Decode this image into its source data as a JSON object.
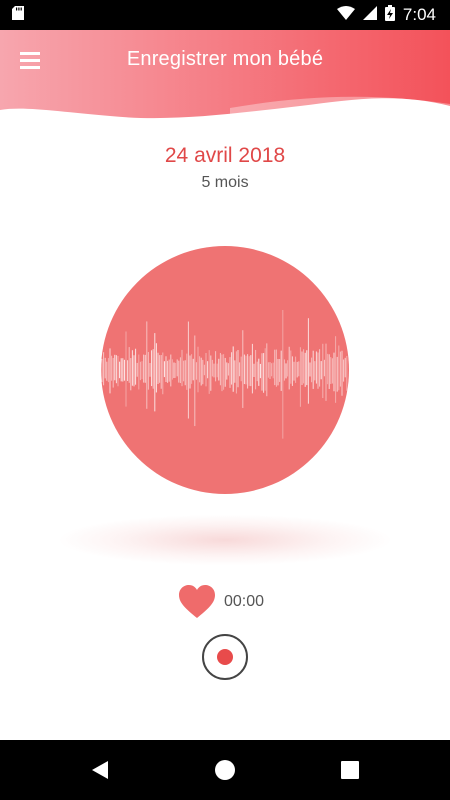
{
  "status_bar": {
    "time": "7:04",
    "icons": [
      "sd-card-icon",
      "wifi-icon",
      "cell-signal-icon",
      "battery-charging-icon"
    ]
  },
  "header": {
    "title": "Enregistrer mon bébé",
    "menu_icon": "hamburger-menu-icon",
    "gradient_colors": [
      "#f7a6ae",
      "#f3525a"
    ]
  },
  "recording": {
    "date": "24 avril 2018",
    "age": "5 mois",
    "timer": "00:00"
  },
  "colors": {
    "accent": "#e04848",
    "circle": "#ef7373",
    "record_dot": "#e84b4b"
  },
  "nav_bar": {
    "icons": [
      "back-icon",
      "home-icon",
      "recents-icon"
    ]
  }
}
